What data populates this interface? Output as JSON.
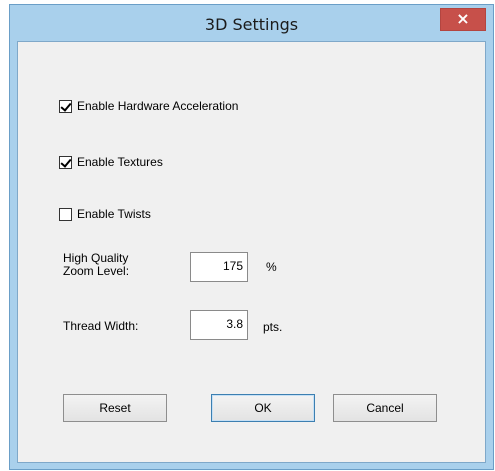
{
  "window": {
    "title": "3D Settings",
    "close_glyph": "×"
  },
  "options": {
    "hardware_acceleration": {
      "label": "Enable Hardware Acceleration",
      "checked": true
    },
    "textures": {
      "label": "Enable Textures",
      "checked": true
    },
    "twists": {
      "label": "Enable Twists",
      "checked": false
    }
  },
  "fields": {
    "zoom": {
      "label_line1": "High Quality",
      "label_line2": "Zoom Level:",
      "value": "175",
      "unit": "%"
    },
    "thread": {
      "label": "Thread Width:",
      "value": "3.8",
      "unit": "pts."
    }
  },
  "buttons": {
    "reset": "Reset",
    "ok": "OK",
    "cancel": "Cancel"
  },
  "icons": {
    "close": "close-icon",
    "check": "checkmark-icon"
  },
  "colors": {
    "frame": "#a9d0ec",
    "close": "#c7504a",
    "client": "#f0f0f0",
    "default_button_border": "#3c7fb1"
  }
}
